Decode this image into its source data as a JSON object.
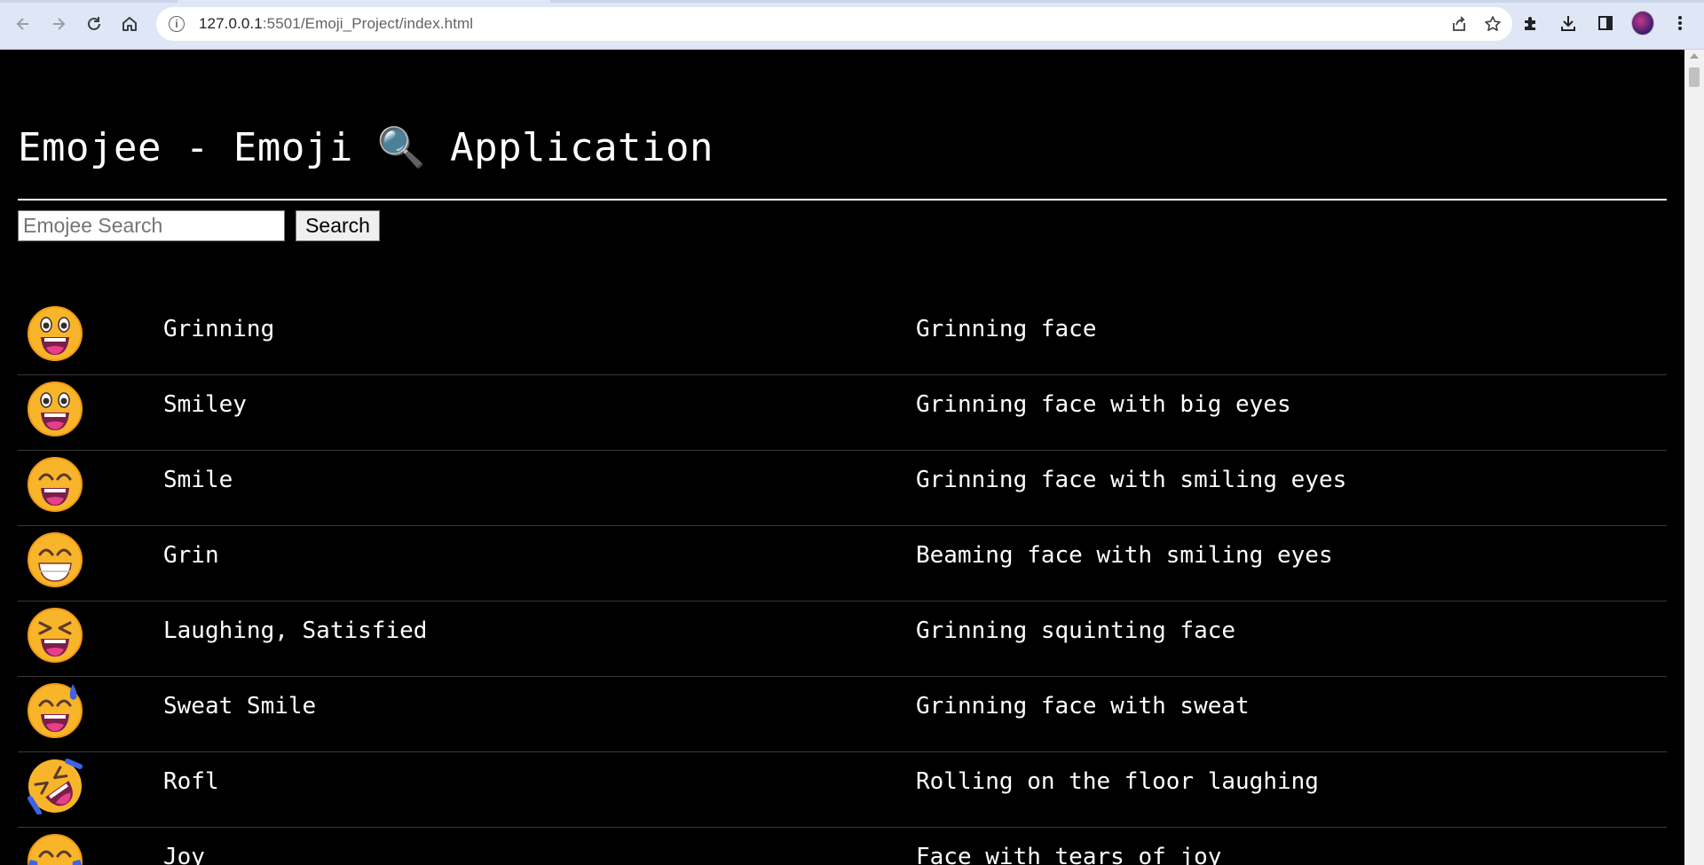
{
  "browser": {
    "url_host": "127.0.0.1",
    "url_rest": ":5501/Emoji_Project/index.html"
  },
  "page": {
    "title": "Emojee - Emoji 🔍 Application",
    "search_placeholder": "Emojee Search",
    "search_button": "Search"
  },
  "emojis": [
    {
      "name": "Grinning",
      "description": "Grinning face",
      "icon": "grinning-face-icon"
    },
    {
      "name": "Smiley",
      "description": "Grinning face with big eyes",
      "icon": "smiley-face-icon"
    },
    {
      "name": "Smile",
      "description": "Grinning face with smiling eyes",
      "icon": "smile-face-icon"
    },
    {
      "name": "Grin",
      "description": "Beaming face with smiling eyes",
      "icon": "grin-face-icon"
    },
    {
      "name": "Laughing, Satisfied",
      "description": "Grinning squinting face",
      "icon": "laughing-face-icon"
    },
    {
      "name": "Sweat Smile",
      "description": "Grinning face with sweat",
      "icon": "sweat-smile-face-icon"
    },
    {
      "name": "Rofl",
      "description": "Rolling on the floor laughing",
      "icon": "rofl-face-icon"
    },
    {
      "name": "Joy",
      "description": "Face with tears of joy",
      "icon": "joy-face-icon"
    }
  ],
  "colors": {
    "face": "#f8b52a",
    "face_shade": "#f09a16",
    "mouth": "#7a1f4a",
    "tongue": "#e83f8a",
    "tear": "#3d63e6"
  }
}
